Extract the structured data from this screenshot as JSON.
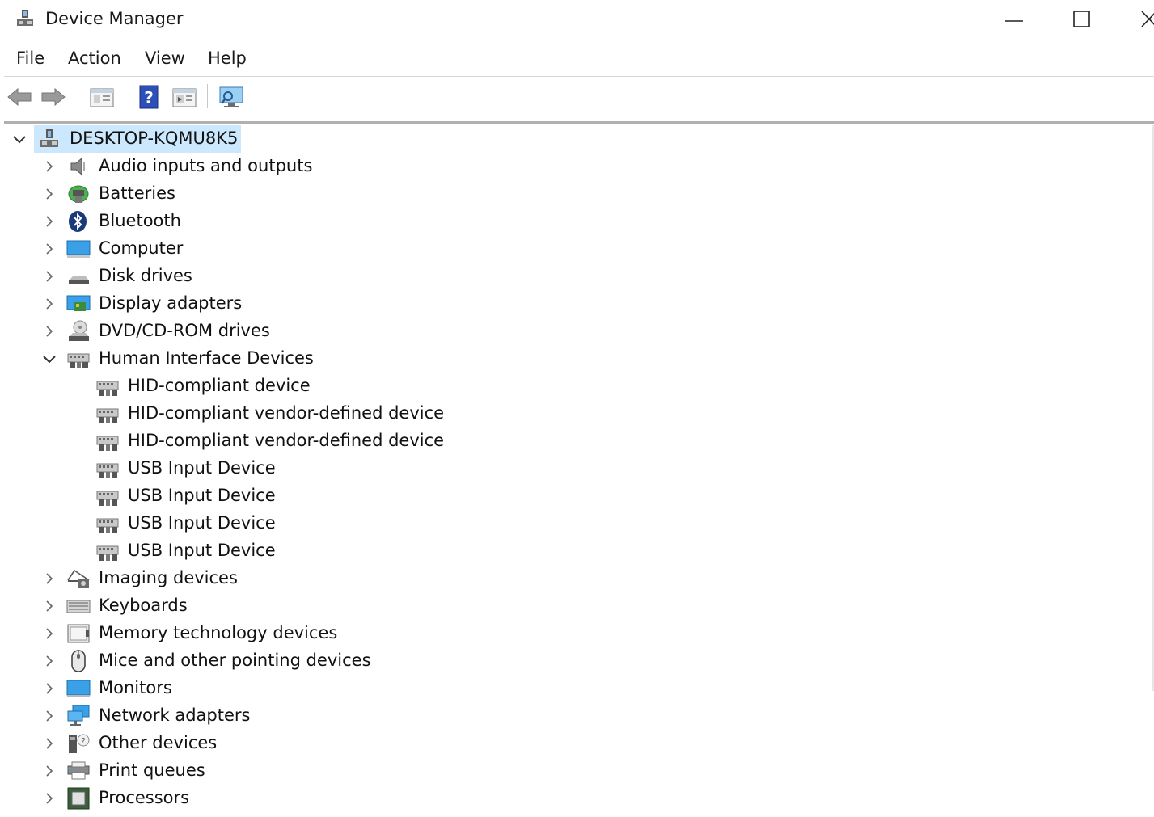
{
  "window": {
    "title": "Device Manager",
    "controls": {
      "minimize": "minimize-icon",
      "maximize": "maximize-icon",
      "close": "close-icon"
    }
  },
  "menu": [
    "File",
    "Action",
    "View",
    "Help"
  ],
  "toolbar": [
    "back-arrow-icon",
    "forward-arrow-icon",
    "properties-window-icon",
    "help-icon",
    "run-window-icon",
    "scan-hardware-monitor-icon"
  ],
  "tree": {
    "root": "DESKTOP-KQMU8K5",
    "categories": [
      {
        "label": "Audio inputs and outputs",
        "icon": "speaker-icon",
        "expanded": false
      },
      {
        "label": "Batteries",
        "icon": "battery-icon",
        "expanded": false
      },
      {
        "label": "Bluetooth",
        "icon": "bluetooth-icon",
        "expanded": false
      },
      {
        "label": "Computer",
        "icon": "computer-icon",
        "expanded": false
      },
      {
        "label": "Disk drives",
        "icon": "disk-drive-icon",
        "expanded": false
      },
      {
        "label": "Display adapters",
        "icon": "display-adapter-icon",
        "expanded": false
      },
      {
        "label": "DVD/CD-ROM drives",
        "icon": "dvd-drive-icon",
        "expanded": false
      },
      {
        "label": "Human Interface Devices",
        "icon": "hid-icon",
        "expanded": true,
        "children": [
          "HID-compliant device",
          "HID-compliant vendor-defined device",
          "HID-compliant vendor-defined device",
          "USB Input Device",
          "USB Input Device",
          "USB Input Device",
          "USB Input Device"
        ]
      },
      {
        "label": "Imaging devices",
        "icon": "camera-icon",
        "expanded": false
      },
      {
        "label": "Keyboards",
        "icon": "keyboard-icon",
        "expanded": false
      },
      {
        "label": "Memory technology devices",
        "icon": "memory-card-icon",
        "expanded": false
      },
      {
        "label": "Mice and other pointing devices",
        "icon": "mouse-icon",
        "expanded": false
      },
      {
        "label": "Monitors",
        "icon": "monitor-icon",
        "expanded": false
      },
      {
        "label": "Network adapters",
        "icon": "network-adapter-icon",
        "expanded": false
      },
      {
        "label": "Other devices",
        "icon": "unknown-device-icon",
        "expanded": false
      },
      {
        "label": "Print queues",
        "icon": "printer-icon",
        "expanded": false
      },
      {
        "label": "Processors",
        "icon": "processor-icon",
        "expanded": false
      }
    ]
  },
  "colors": {
    "selection": "#cce8ff",
    "accent": "#1e88d6"
  }
}
